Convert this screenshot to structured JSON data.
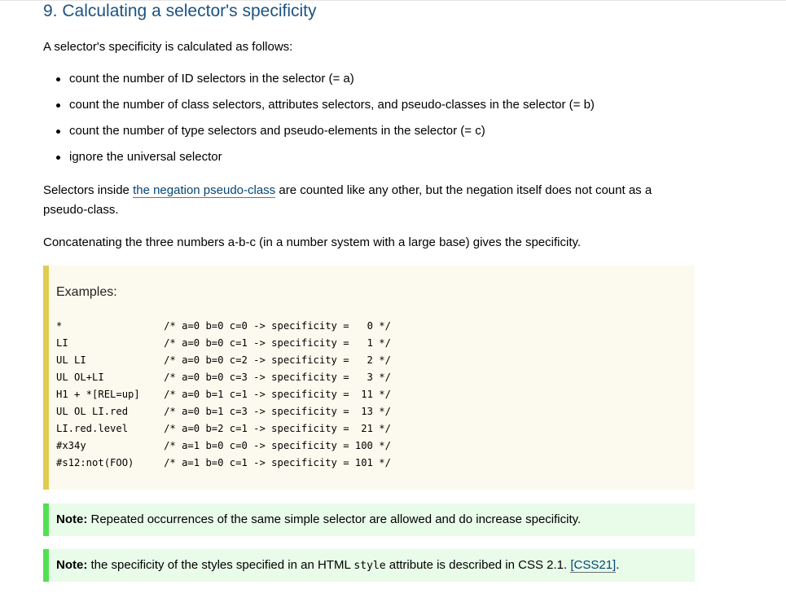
{
  "heading": "9. Calculating a selector's specificity",
  "intro": "A selector's specificity is calculated as follows:",
  "bullets": [
    "count the number of ID selectors in the selector (= a)",
    "count the number of class selectors, attributes selectors, and pseudo-classes in the selector (= b)",
    "count the number of type selectors and pseudo-elements in the selector (= c)",
    "ignore the universal selector"
  ],
  "negation": {
    "before": "Selectors inside ",
    "link": "the negation pseudo-class",
    "after": " are counted like any other, but the negation itself does not count as a pseudo-class."
  },
  "concat": "Concatenating the three numbers a-b-c (in a number system with a large base) gives the specificity.",
  "example": {
    "title": "Examples:",
    "rows": [
      {
        "selector": "*",
        "comment": "/* a=0 b=0 c=0 -> specificity =   0 */"
      },
      {
        "selector": "LI",
        "comment": "/* a=0 b=0 c=1 -> specificity =   1 */"
      },
      {
        "selector": "UL LI",
        "comment": "/* a=0 b=0 c=2 -> specificity =   2 */"
      },
      {
        "selector": "UL OL+LI",
        "comment": "/* a=0 b=0 c=3 -> specificity =   3 */"
      },
      {
        "selector": "H1 + *[REL=up]",
        "comment": "/* a=0 b=1 c=1 -> specificity =  11 */"
      },
      {
        "selector": "UL OL LI.red",
        "comment": "/* a=0 b=1 c=3 -> specificity =  13 */"
      },
      {
        "selector": "LI.red.level",
        "comment": "/* a=0 b=2 c=1 -> specificity =  21 */"
      },
      {
        "selector": "#x34y",
        "comment": "/* a=1 b=0 c=0 -> specificity = 100 */"
      },
      {
        "selector": "#s12:not(FOO)",
        "comment": "/* a=1 b=0 c=1 -> specificity = 101 */"
      }
    ]
  },
  "note1": {
    "label": "Note:",
    "text": " Repeated occurrences of the same simple selector are allowed and do increase specificity."
  },
  "note2": {
    "label": "Note:",
    "text1": " the specificity of the styles specified in an HTML ",
    "code": "style",
    "text2": " attribute is described in CSS 2.1. ",
    "link": "[CSS21]",
    "text3": "."
  }
}
